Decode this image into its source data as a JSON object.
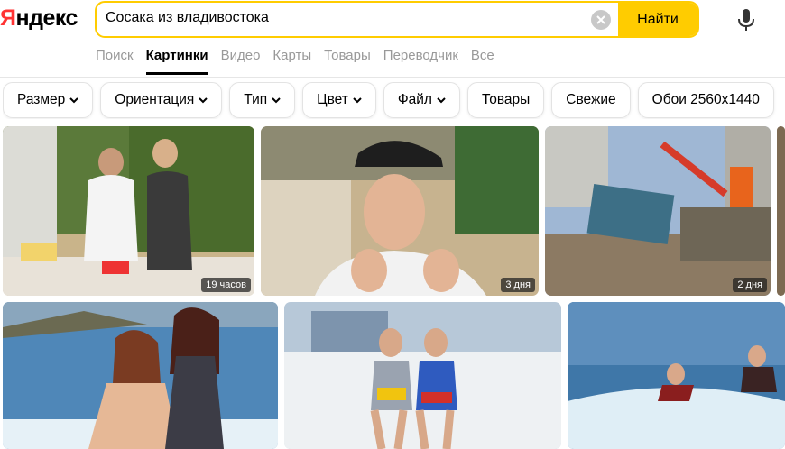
{
  "logo": {
    "first": "Я",
    "rest": "ндекс"
  },
  "search": {
    "query": "Сосака из владивостока",
    "button_label": "Найти"
  },
  "tabs": [
    {
      "label": "Поиск"
    },
    {
      "label": "Картинки"
    },
    {
      "label": "Видео"
    },
    {
      "label": "Карты"
    },
    {
      "label": "Товары"
    },
    {
      "label": "Переводчик"
    },
    {
      "label": "Все"
    }
  ],
  "filters": [
    {
      "label": "Размер"
    },
    {
      "label": "Ориентация"
    },
    {
      "label": "Тип"
    },
    {
      "label": "Цвет"
    },
    {
      "label": "Файл"
    },
    {
      "label": "Товары"
    },
    {
      "label": "Свежие"
    },
    {
      "label": "Обои 2560x1440"
    }
  ],
  "results": [
    {
      "badge": "19 часов"
    },
    {
      "badge": "3 дня"
    },
    {
      "badge": "2 дня"
    },
    {
      "badge": ""
    },
    {
      "badge": ""
    },
    {
      "badge": ""
    }
  ],
  "colors": {
    "accent": "#ffcc00",
    "logo_red": "#ff3333",
    "tab_inactive": "#999999"
  }
}
